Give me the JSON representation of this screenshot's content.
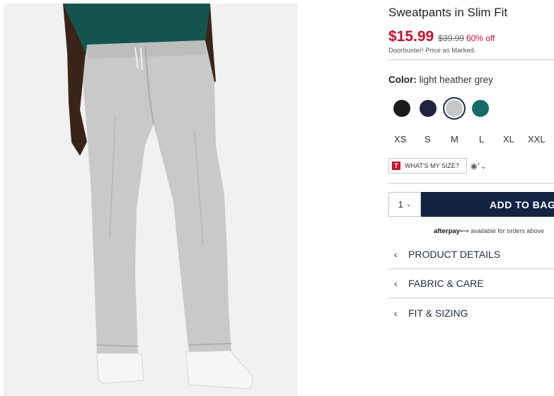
{
  "product": {
    "title": "Sweatpants in Slim Fit",
    "price": "$15.99",
    "original_price": "$39.99",
    "percent_off": "60% off",
    "promo_note": "Doorbuster! Price as Marked."
  },
  "color": {
    "label": "Color:",
    "selected": "light heather grey",
    "swatches": [
      {
        "name": "black",
        "hex": "#1a1a1a"
      },
      {
        "name": "navy",
        "hex": "#1f2340"
      },
      {
        "name": "light heather grey",
        "hex": "#c7c7c7",
        "selected": true
      },
      {
        "name": "teal",
        "hex": "#146b61"
      }
    ]
  },
  "sizes": [
    "XS",
    "S",
    "M",
    "L",
    "XL",
    "XXL"
  ],
  "fit_tool": {
    "badge": "T",
    "label": "WHAT'S MY SIZE?"
  },
  "cart": {
    "quantity": "1",
    "add_button": "ADD TO BAG"
  },
  "afterpay": {
    "brand": "afterpay",
    "text": "available for orders above"
  },
  "accordion": [
    {
      "label": "PRODUCT DETAILS"
    },
    {
      "label": "FABRIC & CARE"
    },
    {
      "label": "FIT & SIZING"
    }
  ],
  "colors": {
    "sale_red": "#c8102e",
    "navy_button": "#122344",
    "link_navy": "#1d2d4a"
  }
}
